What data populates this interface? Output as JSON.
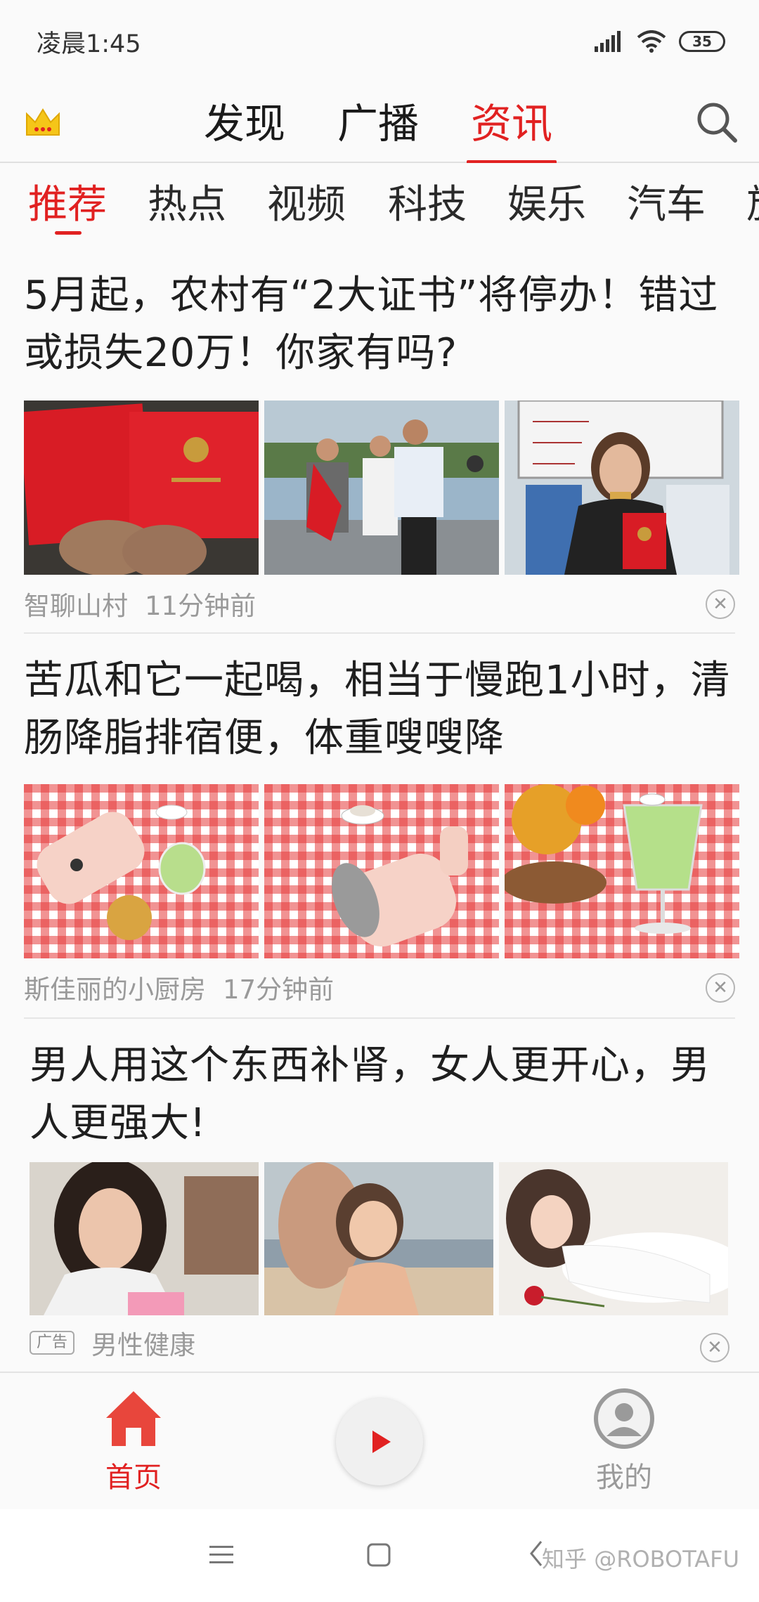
{
  "status_bar": {
    "time": "凌晨1:45",
    "battery": "35"
  },
  "top_tabs": [
    {
      "label": "发现",
      "active": false
    },
    {
      "label": "广播",
      "active": false
    },
    {
      "label": "资讯",
      "active": true
    }
  ],
  "categories": [
    {
      "label": "推荐",
      "active": true
    },
    {
      "label": "热点",
      "active": false
    },
    {
      "label": "视频",
      "active": false
    },
    {
      "label": "科技",
      "active": false
    },
    {
      "label": "娱乐",
      "active": false
    },
    {
      "label": "汽车",
      "active": false
    },
    {
      "label": "旅",
      "active": false
    }
  ],
  "articles": [
    {
      "title": "5月起，农村有“2大证书”将停办！错过或损失20万！你家有吗?",
      "source": "智聊山村",
      "time": "11分钟前",
      "images": [
        "red-certificate-photo",
        "award-ceremony-photo",
        "woman-with-certificate-photo"
      ]
    },
    {
      "title": "苦瓜和它一起喝，相当于慢跑1小时，清肠降脂排宿便，体重嗖嗖降",
      "source": "斯佳丽的小厨房",
      "time": "17分钟前",
      "images": [
        "juicer-photo",
        "juicer-cup-photo",
        "juice-glass-photo"
      ]
    },
    {
      "title": "男人用这个东西补肾，女人更开心，男人更强大!",
      "ad_badge": "广告",
      "source": "男性健康",
      "images": [
        "woman-portrait-photo",
        "beach-couple-photo",
        "woman-lying-photo"
      ]
    }
  ],
  "bottom_nav": {
    "home_label": "首页",
    "mine_label": "我的"
  },
  "watermark": "知乎 @ROBOTAFU",
  "colors": {
    "accent": "#e12121",
    "text": "#1f1f1f",
    "meta": "#9a9a9a"
  }
}
